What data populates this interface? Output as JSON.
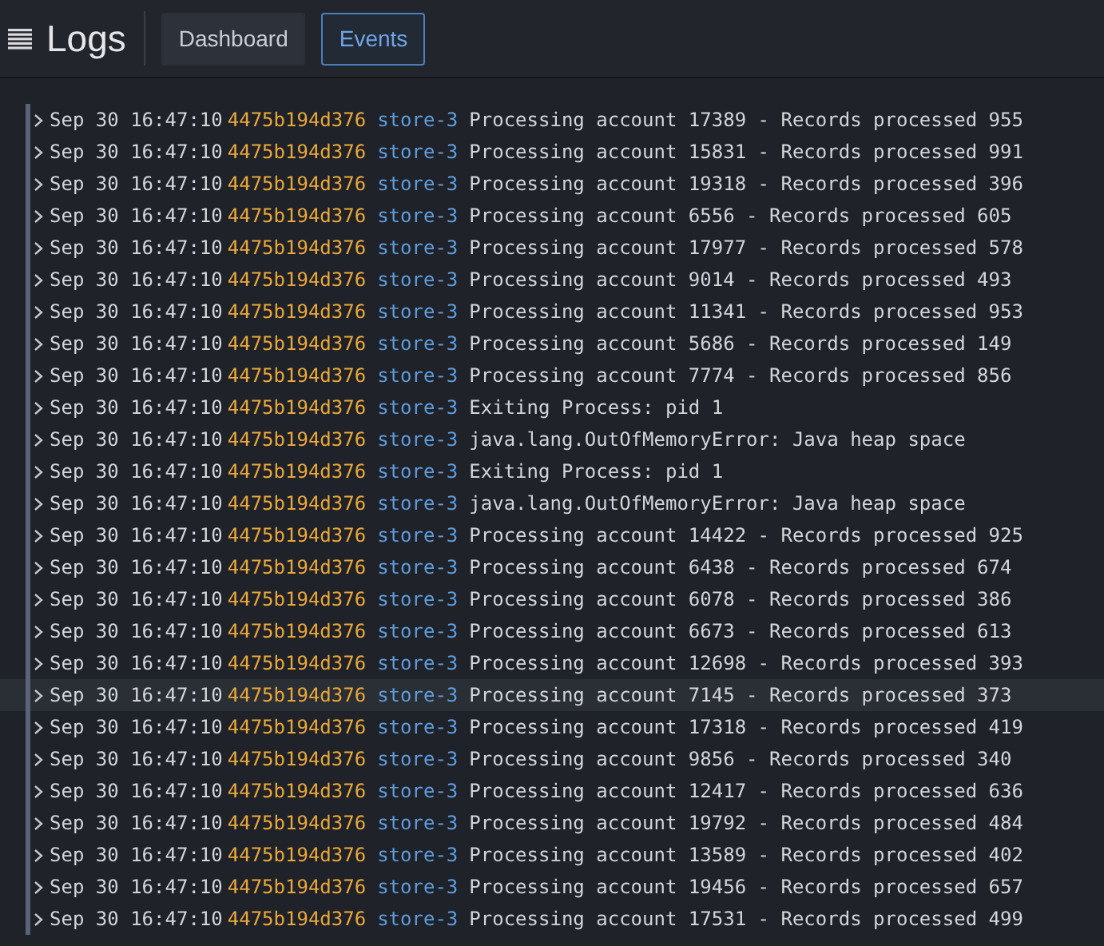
{
  "header": {
    "title": "Logs",
    "tabs": [
      {
        "label": "Dashboard",
        "selected": false
      },
      {
        "label": "Events",
        "selected": true
      }
    ]
  },
  "rows": [
    {
      "time": "Sep 30 16:47:10",
      "host": "4475b194d376",
      "source": "store-3",
      "message": "Processing account 17389 - Records processed 955",
      "highlighted": false
    },
    {
      "time": "Sep 30 16:47:10",
      "host": "4475b194d376",
      "source": "store-3",
      "message": "Processing account 15831 - Records processed 991",
      "highlighted": false
    },
    {
      "time": "Sep 30 16:47:10",
      "host": "4475b194d376",
      "source": "store-3",
      "message": "Processing account 19318 - Records processed 396",
      "highlighted": false
    },
    {
      "time": "Sep 30 16:47:10",
      "host": "4475b194d376",
      "source": "store-3",
      "message": "Processing account 6556 - Records processed 605",
      "highlighted": false
    },
    {
      "time": "Sep 30 16:47:10",
      "host": "4475b194d376",
      "source": "store-3",
      "message": "Processing account 17977 - Records processed 578",
      "highlighted": false
    },
    {
      "time": "Sep 30 16:47:10",
      "host": "4475b194d376",
      "source": "store-3",
      "message": "Processing account 9014 - Records processed 493",
      "highlighted": false
    },
    {
      "time": "Sep 30 16:47:10",
      "host": "4475b194d376",
      "source": "store-3",
      "message": "Processing account 11341 - Records processed 953",
      "highlighted": false
    },
    {
      "time": "Sep 30 16:47:10",
      "host": "4475b194d376",
      "source": "store-3",
      "message": "Processing account 5686 - Records processed 149",
      "highlighted": false
    },
    {
      "time": "Sep 30 16:47:10",
      "host": "4475b194d376",
      "source": "store-3",
      "message": "Processing account 7774 - Records processed 856",
      "highlighted": false
    },
    {
      "time": "Sep 30 16:47:10",
      "host": "4475b194d376",
      "source": "store-3",
      "message": "Exiting Process: pid 1",
      "highlighted": false
    },
    {
      "time": "Sep 30 16:47:10",
      "host": "4475b194d376",
      "source": "store-3",
      "message": "java.lang.OutOfMemoryError: Java heap space",
      "highlighted": false
    },
    {
      "time": "Sep 30 16:47:10",
      "host": "4475b194d376",
      "source": "store-3",
      "message": "Exiting Process: pid 1",
      "highlighted": false
    },
    {
      "time": "Sep 30 16:47:10",
      "host": "4475b194d376",
      "source": "store-3",
      "message": "java.lang.OutOfMemoryError: Java heap space",
      "highlighted": false
    },
    {
      "time": "Sep 30 16:47:10",
      "host": "4475b194d376",
      "source": "store-3",
      "message": "Processing account 14422 - Records processed 925",
      "highlighted": false
    },
    {
      "time": "Sep 30 16:47:10",
      "host": "4475b194d376",
      "source": "store-3",
      "message": "Processing account 6438 - Records processed 674",
      "highlighted": false
    },
    {
      "time": "Sep 30 16:47:10",
      "host": "4475b194d376",
      "source": "store-3",
      "message": "Processing account 6078 - Records processed 386",
      "highlighted": false
    },
    {
      "time": "Sep 30 16:47:10",
      "host": "4475b194d376",
      "source": "store-3",
      "message": "Processing account 6673 - Records processed 613",
      "highlighted": false
    },
    {
      "time": "Sep 30 16:47:10",
      "host": "4475b194d376",
      "source": "store-3",
      "message": "Processing account 12698 - Records processed 393",
      "highlighted": false
    },
    {
      "time": "Sep 30 16:47:10",
      "host": "4475b194d376",
      "source": "store-3",
      "message": "Processing account 7145 - Records processed 373",
      "highlighted": true
    },
    {
      "time": "Sep 30 16:47:10",
      "host": "4475b194d376",
      "source": "store-3",
      "message": "Processing account 17318 - Records processed 419",
      "highlighted": false
    },
    {
      "time": "Sep 30 16:47:10",
      "host": "4475b194d376",
      "source": "store-3",
      "message": "Processing account 9856 - Records processed 340",
      "highlighted": false
    },
    {
      "time": "Sep 30 16:47:10",
      "host": "4475b194d376",
      "source": "store-3",
      "message": "Processing account 12417 - Records processed 636",
      "highlighted": false
    },
    {
      "time": "Sep 30 16:47:10",
      "host": "4475b194d376",
      "source": "store-3",
      "message": "Processing account 19792 - Records processed 484",
      "highlighted": false
    },
    {
      "time": "Sep 30 16:47:10",
      "host": "4475b194d376",
      "source": "store-3",
      "message": "Processing account 13589 - Records processed 402",
      "highlighted": false
    },
    {
      "time": "Sep 30 16:47:10",
      "host": "4475b194d376",
      "source": "store-3",
      "message": "Processing account 19456 - Records processed 657",
      "highlighted": false
    },
    {
      "time": "Sep 30 16:47:10",
      "host": "4475b194d376",
      "source": "store-3",
      "message": "Processing account 17531 - Records processed 499",
      "highlighted": false
    }
  ]
}
